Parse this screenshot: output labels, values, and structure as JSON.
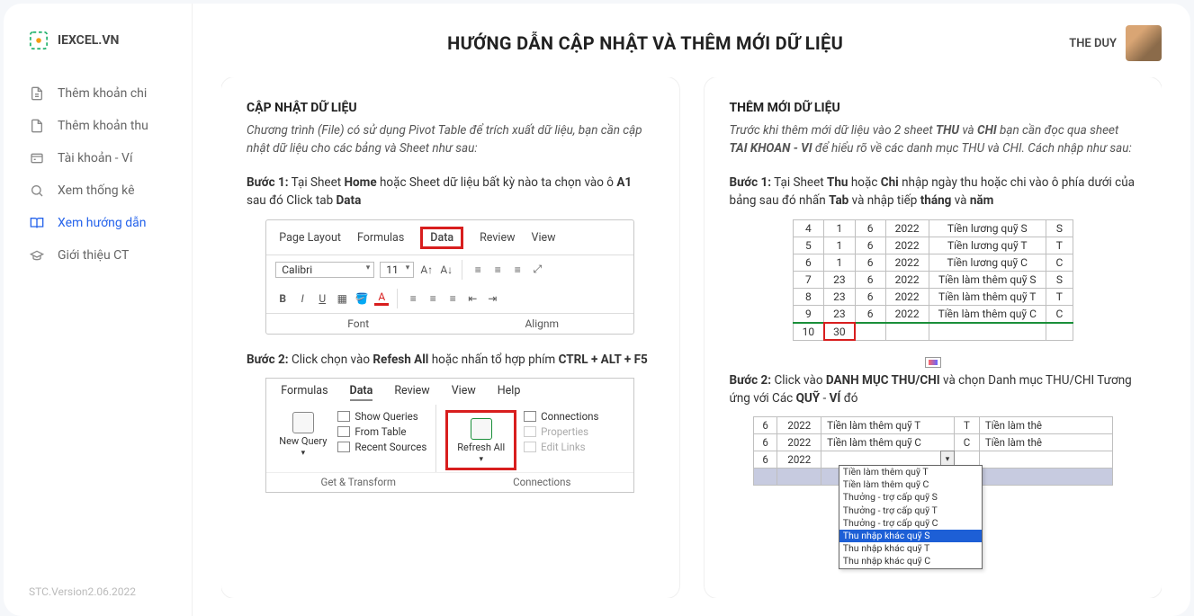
{
  "brand": "IEXCEL.VN",
  "user_name": "THE DUY",
  "page_title": "HƯỚNG DẪN CẬP NHẬT VÀ THÊM MỚI DỮ LIỆU",
  "version": "STC.Version2.06.2022",
  "nav": [
    {
      "label": "Thêm khoản chi"
    },
    {
      "label": "Thêm khoản thu"
    },
    {
      "label": "Tài khoản - Ví"
    },
    {
      "label": "Xem thống kê"
    },
    {
      "label": "Xem hướng dẫn"
    },
    {
      "label": "Giới thiệu CT"
    }
  ],
  "left": {
    "heading": "CẬP NHẬT DỮ LIỆU",
    "intro": "Chương trình (File) có sử dụng Pivot Table để trích xuất dữ liệu, bạn cần cập nhật dữ liệu cho các bảng và Sheet như sau:",
    "step1_a": "Bước 1:",
    "step1_b": " Tại Sheet ",
    "step1_c": "Home",
    "step1_d": " hoặc Sheet dữ liệu bất kỳ nào ta chọn vào ô ",
    "step1_e": "A1",
    "step1_f": " sau đó Click tab ",
    "step1_g": "Data",
    "ribbon_tabs": [
      "Page Layout",
      "Formulas",
      "Data",
      "Review",
      "View"
    ],
    "font_name": "Calibri",
    "font_size": "11",
    "group_font": "Font",
    "group_align": "Alignm",
    "step2_a": "Bước 2:",
    "step2_b": " Click chọn vào ",
    "step2_c": "Refesh All",
    "step2_d": " hoặc nhấn tổ hợp phím ",
    "step2_e": "CTRL + ALT + F5",
    "ribbon2_tabs": [
      "Formulas",
      "Data",
      "Review",
      "View",
      "Help"
    ],
    "new_query": "New Query",
    "show_queries": "Show Queries",
    "from_table": "From Table",
    "recent_sources": "Recent Sources",
    "get_transform": "Get & Transform",
    "refresh_all": "Refresh All",
    "connections": "Connections",
    "properties": "Properties",
    "edit_links": "Edit Links",
    "group_connections": "Connections"
  },
  "right": {
    "heading": "THÊM MỚI DỮ LIỆU",
    "intro_a": "Trước khi thêm mới dữ liệu vào 2 sheet ",
    "intro_b": "THU",
    "intro_c": " và ",
    "intro_d": "CHI",
    "intro_e": " bạn cần đọc qua sheet ",
    "intro_f": "TAI KHOAN - VI",
    "intro_g": " để hiểu rõ về các danh mục THU và CHI. Cách nhập như sau:",
    "step1_a": "Bước 1:",
    "step1_b": " Tại Sheet ",
    "step1_c": "Thu",
    "step1_d": " hoặc ",
    "step1_e": "Chi",
    "step1_f": " nhập ngày thu hoặc chi vào ô phía dưới của bảng sau đó nhấn ",
    "step1_g": "Tab",
    "step1_h": " và nhập tiếp ",
    "step1_i": "tháng",
    "step1_j": " và ",
    "step1_k": "năm",
    "table1": [
      [
        "4",
        "1",
        "6",
        "2022",
        "Tiền lương quỹ S",
        "S"
      ],
      [
        "5",
        "1",
        "6",
        "2022",
        "Tiền lương quỹ T",
        "T"
      ],
      [
        "6",
        "1",
        "6",
        "2022",
        "Tiền lương quỹ C",
        "C"
      ],
      [
        "7",
        "23",
        "6",
        "2022",
        "Tiền làm thêm quỹ S",
        "S"
      ],
      [
        "8",
        "23",
        "6",
        "2022",
        "Tiền làm thêm quỹ T",
        "T"
      ],
      [
        "9",
        "23",
        "6",
        "2022",
        "Tiền làm thêm quỹ C",
        "C"
      ],
      [
        "10",
        "30",
        "",
        "",
        "",
        ""
      ]
    ],
    "step2_a": "Bước 2:",
    "step2_b": " Click vào ",
    "step2_c": "DANH MỤC THU/CHI",
    "step2_d": " và chọn Danh mục THU/CHI Tương ứng với Các ",
    "step2_e": "QUỸ",
    "step2_f": " -  ",
    "step2_g": "VÍ",
    "step2_h": " đó",
    "table2": [
      [
        "6",
        "2022",
        "Tiền làm thêm quỹ T",
        "T",
        "Tiền làm thê"
      ],
      [
        "6",
        "2022",
        "Tiền làm thêm quỹ C",
        "C",
        "Tiền làm thê"
      ],
      [
        "6",
        "2022",
        "",
        "",
        ""
      ]
    ],
    "dd_options": [
      "Tiền làm thêm quỹ T",
      "Tiền làm thêm quỹ C",
      "Thưởng - trợ cấp quỹ S",
      "Thưởng - trợ cấp quỹ T",
      "Thưởng - trợ cấp quỹ C",
      "Thu nhập khác quỹ S",
      "Thu nhập khác quỹ T",
      "Thu nhập khác quỹ C"
    ]
  }
}
